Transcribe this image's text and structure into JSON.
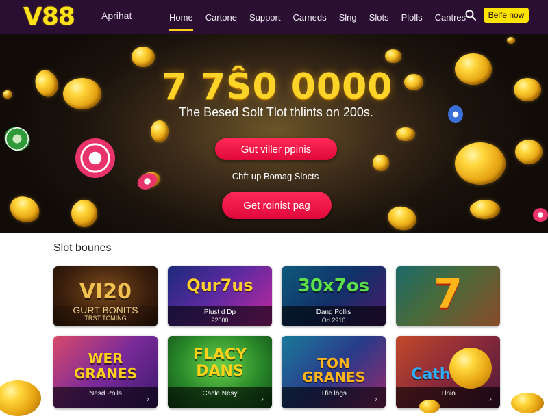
{
  "header": {
    "logo": "V88",
    "tagline": "Aprihat",
    "nav": [
      "Home",
      "Cartone",
      "Support",
      "Carneds",
      "Slng",
      "Slots",
      "Plolls",
      "Cantres"
    ],
    "active_nav": "Home",
    "search_icon": "search-icon",
    "cta_label": "Belfe now"
  },
  "hero": {
    "title": "7 7Ŝ0 0000",
    "subtitle": "The Besed Solt Tlot thlints on 200s.",
    "primary_button": "Gut viller ppinis",
    "mid_text": "Chft-up Bomag Slocts",
    "secondary_button": "Get roinist pag"
  },
  "slots": {
    "section_title": "Slot bounes",
    "cards": [
      {
        "art": "VI20",
        "line1": "GURT BONITS",
        "line2": "TRST TCMING"
      },
      {
        "art": "Qur7us",
        "line1": "Plust d Dp",
        "line2": "22000"
      },
      {
        "art": "30x7os",
        "line1": "Dang Pollis",
        "line2": "Orl 2910"
      },
      {
        "art": "7",
        "line1": "",
        "line2": ""
      },
      {
        "art": "WER GRANES",
        "line1": "Nesd Polls",
        "line2": ""
      },
      {
        "art": "FLACY DANS",
        "line1": "Cacle Nesy",
        "line2": ""
      },
      {
        "art": "TON GRANES",
        "line1": "Tfie lhgs",
        "line2": ""
      },
      {
        "art": "Cath",
        "line1": "Tlnio",
        "line2": ""
      }
    ]
  },
  "colors": {
    "header_bg": "#2a0f33",
    "accent_yellow": "#ffe400",
    "button_red": "#e80c3e",
    "gold": "#ffd428"
  }
}
